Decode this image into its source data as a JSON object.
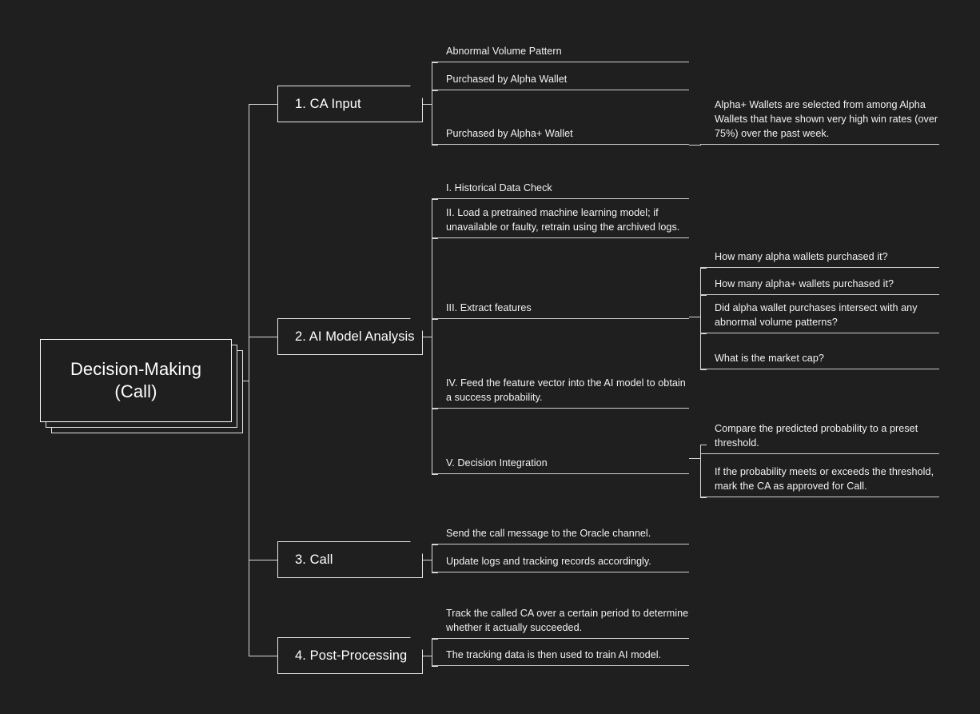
{
  "diagram": {
    "type": "mind-map",
    "title": "Decision-Making (Call)",
    "background_color": "#1f1f1f",
    "line_color": "#d8d8d8",
    "text_color": "#f2f2f2"
  },
  "root": {
    "label": "Decision-Making\n(Call)"
  },
  "branches": [
    {
      "id": "ca-input",
      "label": "1. CA Input",
      "children": [
        {
          "id": "abnormal-volume-pattern",
          "label": "Abnormal Volume Pattern",
          "children": []
        },
        {
          "id": "purchased-by-alpha-wallet",
          "label": "Purchased by Alpha Wallet",
          "children": []
        },
        {
          "id": "purchased-by-alpha-plus-wallet",
          "label": "Purchased by Alpha+ Wallet",
          "children": [
            {
              "id": "alpha-plus-definition",
              "label": "Alpha+ Wallets are selected from among Alpha Wallets that have shown very high win rates (over 75%) over the past week."
            }
          ]
        }
      ]
    },
    {
      "id": "ai-model-analysis",
      "label": "2. AI Model Analysis",
      "children": [
        {
          "id": "historical-data-check",
          "label": "I. Historical Data Check",
          "children": []
        },
        {
          "id": "load-pretrained-model",
          "label": "II. Load a pretrained machine learning model; if unavailable or faulty, retrain using the archived logs.",
          "children": []
        },
        {
          "id": "extract-features",
          "label": "III. Extract features",
          "children": [
            {
              "id": "count-alpha-wallets",
              "label": "How many alpha wallets purchased it?"
            },
            {
              "id": "count-alpha-plus-wallets",
              "label": "How many alpha+ wallets purchased it?"
            },
            {
              "id": "intersect-abnormal-volume",
              "label": "Did alpha wallet purchases intersect with any abnormal volume patterns?"
            },
            {
              "id": "market-cap",
              "label": "What is the market cap?"
            }
          ]
        },
        {
          "id": "feed-feature-vector",
          "label": "IV. Feed the feature vector into the AI model to obtain a success probability.",
          "children": []
        },
        {
          "id": "decision-integration",
          "label": "V. Decision Integration",
          "children": [
            {
              "id": "compare-threshold",
              "label": "Compare the predicted probability to a preset threshold."
            },
            {
              "id": "mark-approved",
              "label": "If the probability meets or exceeds the threshold, mark the CA as approved for Call."
            }
          ]
        }
      ]
    },
    {
      "id": "call",
      "label": "3. Call",
      "children": [
        {
          "id": "send-call-message",
          "label": "Send the call message to the Oracle channel.",
          "children": []
        },
        {
          "id": "update-logs",
          "label": "Update logs and tracking records accordingly.",
          "children": []
        }
      ]
    },
    {
      "id": "post-processing",
      "label": "4. Post-Processing",
      "children": [
        {
          "id": "track-called-ca",
          "label": "Track the called CA over a certain period to determine whether it actually succeeded.",
          "children": []
        },
        {
          "id": "train-ai-model",
          "label": "The tracking data is then used to train AI model.",
          "children": []
        }
      ]
    }
  ]
}
